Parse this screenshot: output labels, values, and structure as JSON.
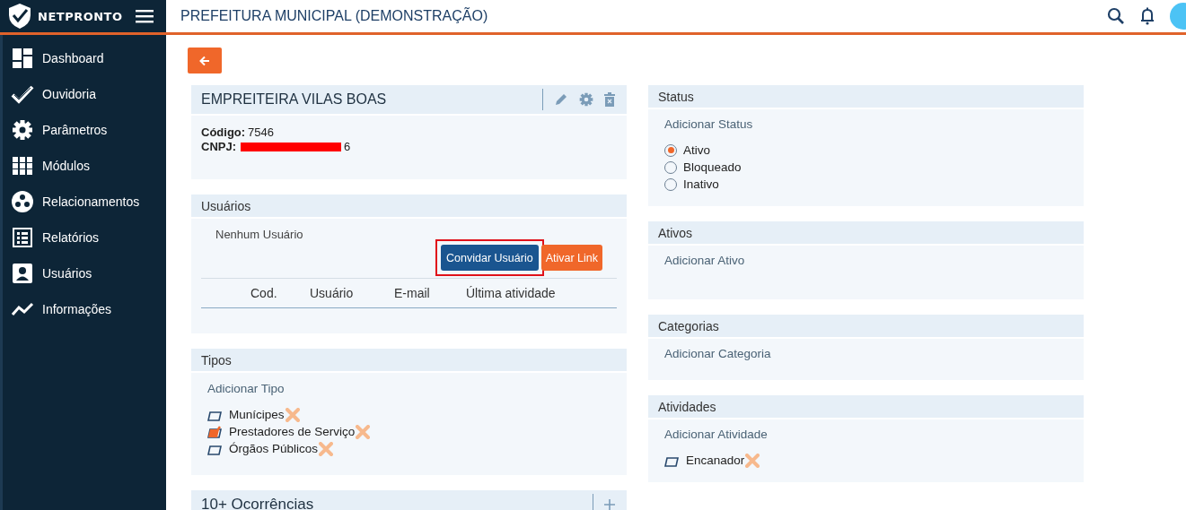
{
  "brand": {
    "name": "NETPRONTO"
  },
  "header": {
    "title": "PREFEITURA MUNICIPAL (DEMONSTRAÇÃO)"
  },
  "sidebar": {
    "items": [
      {
        "label": "Dashboard",
        "kind": "dashboard"
      },
      {
        "label": "Ouvidoria",
        "kind": "check"
      },
      {
        "label": "Parâmetros",
        "kind": "gear"
      },
      {
        "label": "Módulos",
        "kind": "grid"
      },
      {
        "label": "Relacionamentos",
        "kind": "dots"
      },
      {
        "label": "Relatórios",
        "kind": "list"
      },
      {
        "label": "Usuários",
        "kind": "user"
      },
      {
        "label": "Informações",
        "kind": "chart"
      }
    ]
  },
  "entity": {
    "name": "EMPREITEIRA VILAS BOAS",
    "code_label": "Código:",
    "code": "7546",
    "cnpj_label": "CNPJ:",
    "cnpj_redacted": true,
    "cnpj_visible_end": "6"
  },
  "users": {
    "title": "Usuários",
    "empty": "Nenhum Usuário",
    "invite_button": "Convidar Usuário",
    "invite_highlighted": true,
    "link_button": "Ativar Link",
    "columns": [
      "Cod.",
      "Usuário",
      "E-mail",
      "Última atividade"
    ]
  },
  "types": {
    "title": "Tipos",
    "add": "Adicionar Tipo",
    "items": [
      {
        "label": "Munícipes",
        "checked": false
      },
      {
        "label": "Prestadores de Serviço",
        "checked": true
      },
      {
        "label": "Órgãos Públicos",
        "checked": false
      }
    ]
  },
  "occurrences": {
    "title": "10+ Ocorrências"
  },
  "status": {
    "title": "Status",
    "add": "Adicionar Status",
    "options": [
      {
        "label": "Ativo",
        "selected": true
      },
      {
        "label": "Bloqueado",
        "selected": false
      },
      {
        "label": "Inativo",
        "selected": false
      }
    ]
  },
  "assets": {
    "title": "Ativos",
    "add": "Adicionar Ativo"
  },
  "categories": {
    "title": "Categorias",
    "add": "Adicionar Categoria"
  },
  "activities": {
    "title": "Atividades",
    "add": "Adicionar Atividade",
    "items": [
      {
        "label": "Encanador",
        "checked": false
      }
    ]
  }
}
